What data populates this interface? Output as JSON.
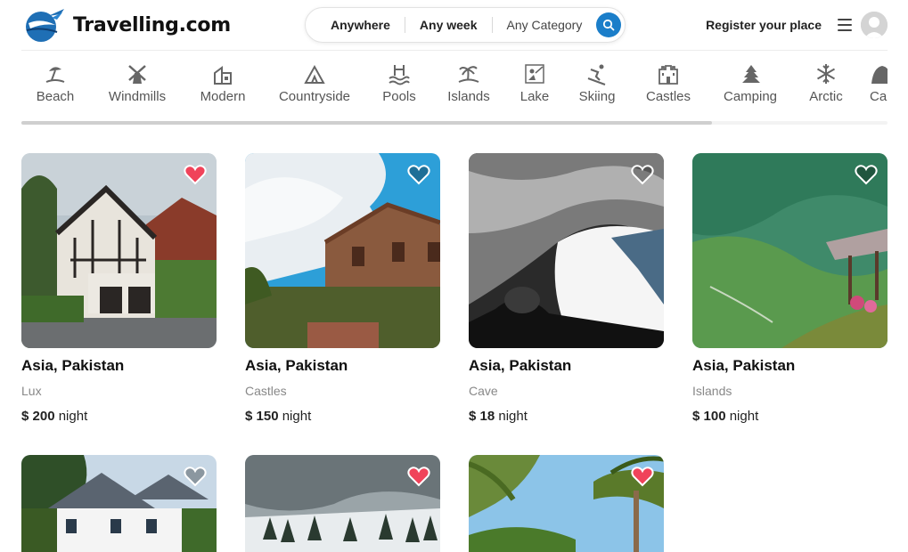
{
  "brand": {
    "name": "Travelling.com"
  },
  "search": {
    "where": "Anywhere",
    "when": "Any week",
    "category": "Any Category"
  },
  "nav": {
    "register": "Register your place"
  },
  "categories": [
    {
      "label": "Beach",
      "icon": "beach-icon"
    },
    {
      "label": "Windmills",
      "icon": "windmill-icon"
    },
    {
      "label": "Modern",
      "icon": "modern-house-icon"
    },
    {
      "label": "Countryside",
      "icon": "tent-icon"
    },
    {
      "label": "Pools",
      "icon": "pool-icon"
    },
    {
      "label": "Islands",
      "icon": "island-icon"
    },
    {
      "label": "Lake",
      "icon": "lake-icon"
    },
    {
      "label": "Skiing",
      "icon": "skiing-icon"
    },
    {
      "label": "Castles",
      "icon": "castle-icon"
    },
    {
      "label": "Camping",
      "icon": "camping-icon"
    },
    {
      "label": "Arctic",
      "icon": "snowflake-icon"
    },
    {
      "label": "Ca",
      "icon": "cave-icon"
    }
  ],
  "listings": [
    {
      "title": "Asia, Pakistan",
      "category": "Lux",
      "price": "$ 200",
      "unit": "night",
      "favorite": true
    },
    {
      "title": "Asia, Pakistan",
      "category": "Castles",
      "price": "$ 150",
      "unit": "night",
      "favorite": false
    },
    {
      "title": "Asia, Pakistan",
      "category": "Cave",
      "price": "$ 18",
      "unit": "night",
      "favorite": false
    },
    {
      "title": "Asia, Pakistan",
      "category": "Islands",
      "price": "$ 100",
      "unit": "night",
      "favorite": false
    },
    {
      "favorite": false
    },
    {
      "favorite": true
    },
    {
      "favorite": true
    }
  ],
  "colors": {
    "accent": "#1b7ec9",
    "favorite": "#f0435a",
    "muted": "#888888"
  }
}
